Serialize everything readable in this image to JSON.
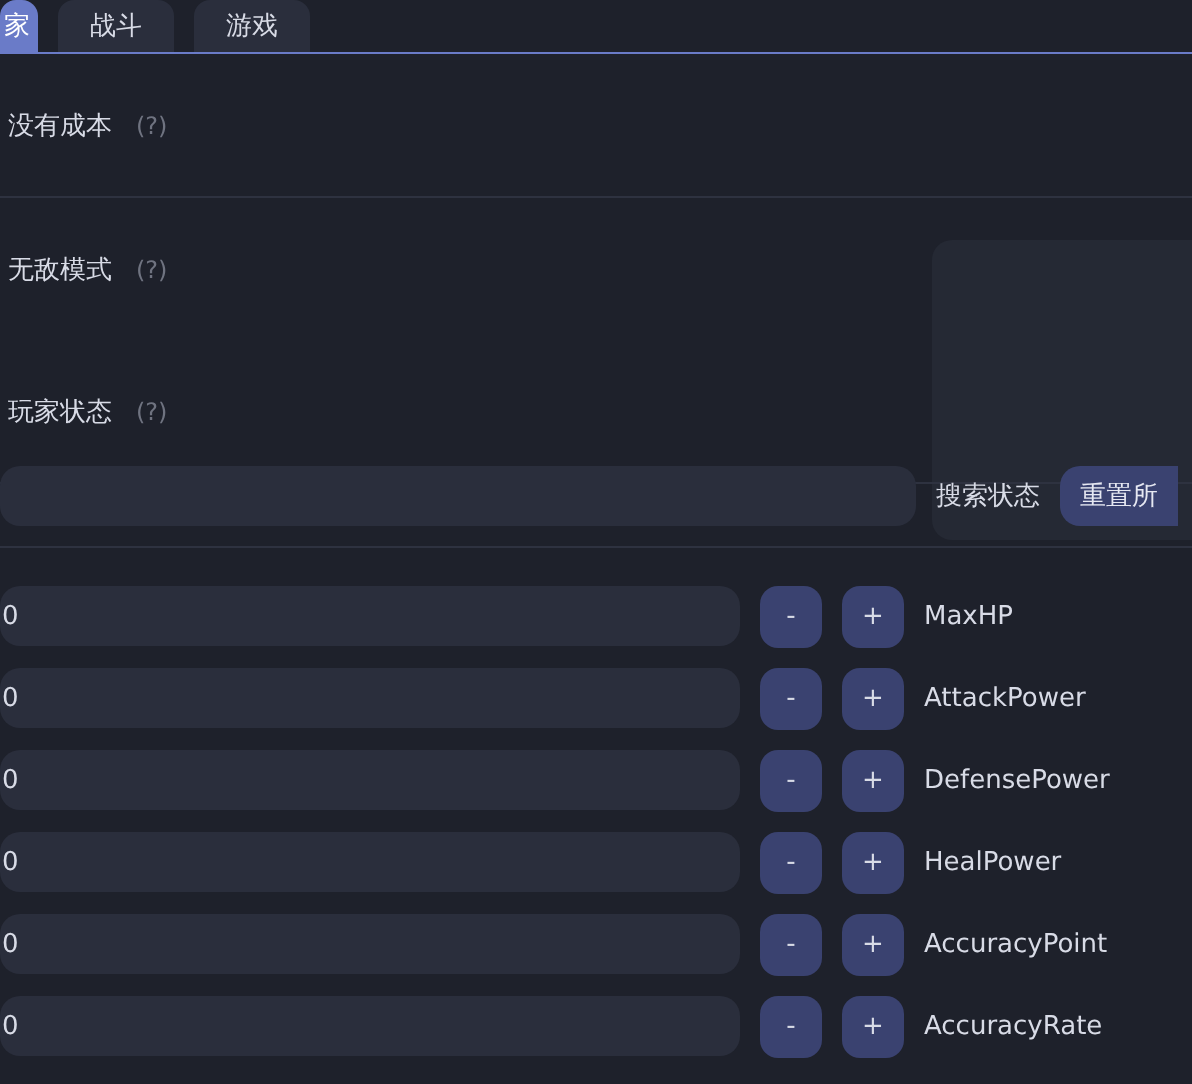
{
  "tabs": [
    {
      "label": "家",
      "selected": true
    },
    {
      "label": "战斗",
      "selected": false
    },
    {
      "label": "游戏",
      "selected": false
    }
  ],
  "options": [
    {
      "label": "没有成本",
      "help": "(?)"
    },
    {
      "label": "无敌模式",
      "help": "(?)"
    },
    {
      "label": "玩家状态",
      "help": "(?)"
    }
  ],
  "search": {
    "button": "搜索状态",
    "reset": "重置所"
  },
  "stats": [
    {
      "value": "0",
      "minus": "-",
      "plus": "+",
      "name": "MaxHP"
    },
    {
      "value": "0",
      "minus": "-",
      "plus": "+",
      "name": "AttackPower"
    },
    {
      "value": "0",
      "minus": "-",
      "plus": "+",
      "name": "DefensePower"
    },
    {
      "value": "0",
      "minus": "-",
      "plus": "+",
      "name": "HealPower"
    },
    {
      "value": "0",
      "minus": "-",
      "plus": "+",
      "name": "AccuracyPoint"
    },
    {
      "value": "0",
      "minus": "-",
      "plus": "+",
      "name": "AccuracyRate"
    }
  ]
}
